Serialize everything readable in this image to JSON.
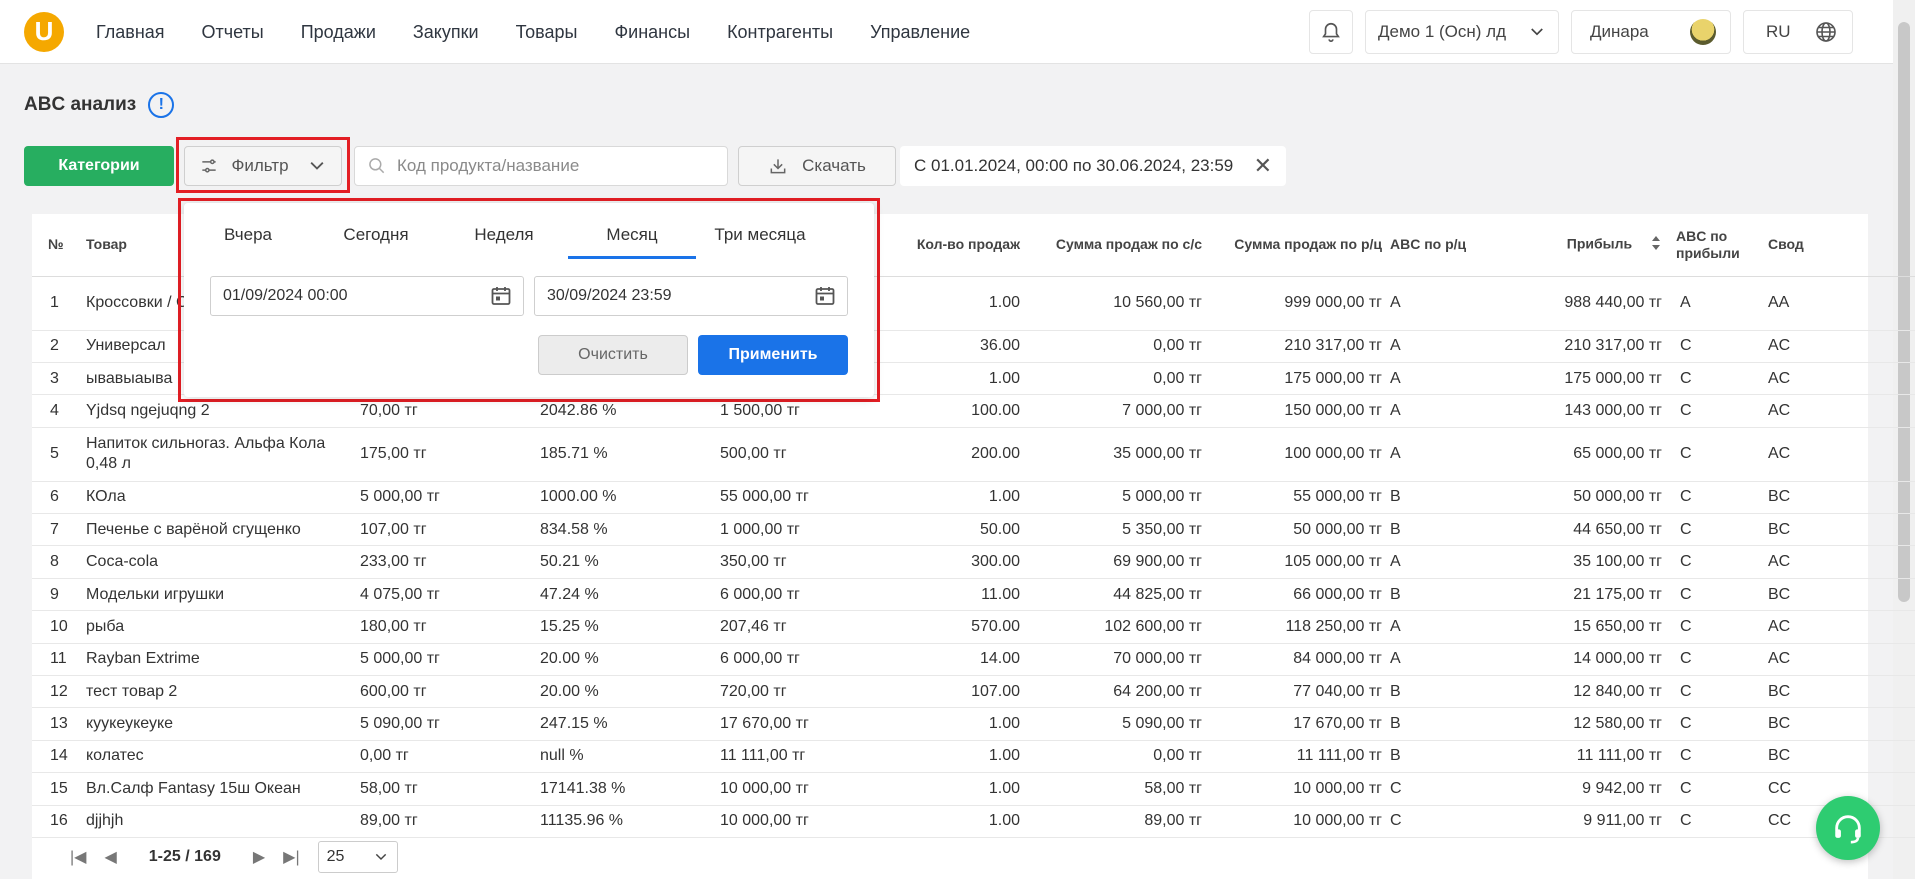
{
  "brand": {
    "logo_letter": "U",
    "accent": "#f5a800"
  },
  "nav": {
    "items": [
      {
        "label": "Главная"
      },
      {
        "label": "Отчеты"
      },
      {
        "label": "Продажи"
      },
      {
        "label": "Закупки"
      },
      {
        "label": "Товары"
      },
      {
        "label": "Финансы"
      },
      {
        "label": "Контрагенты"
      },
      {
        "label": "Управление"
      }
    ]
  },
  "topbar": {
    "company": "Демо 1 (Осн) лд",
    "user": "Динара",
    "lang": "RU"
  },
  "page": {
    "title": "ABC анализ"
  },
  "toolbar": {
    "categories_label": "Категории",
    "filter_label": "Фильтр",
    "search_placeholder": "Код продукта/название",
    "download_label": "Скачать",
    "period_text": "С 01.01.2024, 00:00 по 30.06.2024, 23:59"
  },
  "filter_popup": {
    "tabs": [
      "Вчера",
      "Сегодня",
      "Неделя",
      "Месяц",
      "Три месяца"
    ],
    "active_tab": "Месяц",
    "date_from": "01/09/2024 00:00",
    "date_to": "30/09/2024 23:59",
    "clear_label": "Очистить",
    "apply_label": "Применить"
  },
  "table": {
    "headers": {
      "no": "№",
      "product": "Товар",
      "qty": "Кол-во продаж",
      "sum_cost": "Сумма продаж по с/с",
      "sum_retail": "Сумма продаж по р/ц",
      "abc_retail": "ABC по р/ц",
      "profit": "Прибыль",
      "abc_profit": "ABC по прибыли",
      "summary": "Свод"
    },
    "rows": [
      {
        "no": "1",
        "product": "Кроссовки / С",
        "cost": "",
        "markup": "",
        "retail": "",
        "qty": "1.00",
        "sum_cost": "10 560,00 тг",
        "sum_retail": "999 000,00 тг",
        "abc_retail": "A",
        "profit": "988 440,00 тг",
        "abc_profit": "A",
        "summary": "AA"
      },
      {
        "no": "2",
        "product": "Универсал",
        "cost": "",
        "markup": "",
        "retail": "",
        "qty": "36.00",
        "sum_cost": "0,00 тг",
        "sum_retail": "210 317,00 тг",
        "abc_retail": "A",
        "profit": "210 317,00 тг",
        "abc_profit": "C",
        "summary": "AC"
      },
      {
        "no": "3",
        "product": "ывавыаыва",
        "cost": "",
        "markup": "",
        "retail": "",
        "qty": "1.00",
        "sum_cost": "0,00 тг",
        "sum_retail": "175 000,00 тг",
        "abc_retail": "A",
        "profit": "175 000,00 тг",
        "abc_profit": "C",
        "summary": "AC"
      },
      {
        "no": "4",
        "product": "Yjdsq ngejuqng 2",
        "cost": "70,00 тг",
        "markup": "2042.86 %",
        "retail": "1 500,00 тг",
        "qty": "100.00",
        "sum_cost": "7 000,00 тг",
        "sum_retail": "150 000,00 тг",
        "abc_retail": "A",
        "profit": "143 000,00 тг",
        "abc_profit": "C",
        "summary": "AC"
      },
      {
        "no": "5",
        "product": "Напиток сильногаз. Альфа Кола 0,48 л",
        "cost": "175,00 тг",
        "markup": "185.71 %",
        "retail": "500,00 тг",
        "qty": "200.00",
        "sum_cost": "35 000,00 тг",
        "sum_retail": "100 000,00 тг",
        "abc_retail": "A",
        "profit": "65 000,00 тг",
        "abc_profit": "C",
        "summary": "AC"
      },
      {
        "no": "6",
        "product": "КОла",
        "cost": "5 000,00 тг",
        "markup": "1000.00 %",
        "retail": "55 000,00 тг",
        "qty": "1.00",
        "sum_cost": "5 000,00 тг",
        "sum_retail": "55 000,00 тг",
        "abc_retail": "B",
        "profit": "50 000,00 тг",
        "abc_profit": "C",
        "summary": "BC"
      },
      {
        "no": "7",
        "product": "Печенье с варёной сгущенко",
        "cost": "107,00 тг",
        "markup": "834.58 %",
        "retail": "1 000,00 тг",
        "qty": "50.00",
        "sum_cost": "5 350,00 тг",
        "sum_retail": "50 000,00 тг",
        "abc_retail": "B",
        "profit": "44 650,00 тг",
        "abc_profit": "C",
        "summary": "BC"
      },
      {
        "no": "8",
        "product": "Coca-cola",
        "cost": "233,00 тг",
        "markup": "50.21 %",
        "retail": "350,00 тг",
        "qty": "300.00",
        "sum_cost": "69 900,00 тг",
        "sum_retail": "105 000,00 тг",
        "abc_retail": "A",
        "profit": "35 100,00 тг",
        "abc_profit": "C",
        "summary": "AC"
      },
      {
        "no": "9",
        "product": "Модельки игрушки",
        "cost": "4 075,00 тг",
        "markup": "47.24 %",
        "retail": "6 000,00 тг",
        "qty": "11.00",
        "sum_cost": "44 825,00 тг",
        "sum_retail": "66 000,00 тг",
        "abc_retail": "B",
        "profit": "21 175,00 тг",
        "abc_profit": "C",
        "summary": "BC"
      },
      {
        "no": "10",
        "product": "рыба",
        "cost": "180,00 тг",
        "markup": "15.25 %",
        "retail": "207,46 тг",
        "qty": "570.00",
        "sum_cost": "102 600,00 тг",
        "sum_retail": "118 250,00 тг",
        "abc_retail": "A",
        "profit": "15 650,00 тг",
        "abc_profit": "C",
        "summary": "AC"
      },
      {
        "no": "11",
        "product": "Rayban Extrime",
        "cost": "5 000,00 тг",
        "markup": "20.00 %",
        "retail": "6 000,00 тг",
        "qty": "14.00",
        "sum_cost": "70 000,00 тг",
        "sum_retail": "84 000,00 тг",
        "abc_retail": "A",
        "profit": "14 000,00 тг",
        "abc_profit": "C",
        "summary": "AC"
      },
      {
        "no": "12",
        "product": "тест товар 2",
        "cost": "600,00 тг",
        "markup": "20.00 %",
        "retail": "720,00 тг",
        "qty": "107.00",
        "sum_cost": "64 200,00 тг",
        "sum_retail": "77 040,00 тг",
        "abc_retail": "B",
        "profit": "12 840,00 тг",
        "abc_profit": "C",
        "summary": "BC"
      },
      {
        "no": "13",
        "product": "куукеукеуке",
        "cost": "5 090,00 тг",
        "markup": "247.15 %",
        "retail": "17 670,00 тг",
        "qty": "1.00",
        "sum_cost": "5 090,00 тг",
        "sum_retail": "17 670,00 тг",
        "abc_retail": "B",
        "profit": "12 580,00 тг",
        "abc_profit": "C",
        "summary": "BC"
      },
      {
        "no": "14",
        "product": "колатес",
        "cost": "0,00 тг",
        "markup": "null %",
        "retail": "11 111,00 тг",
        "qty": "1.00",
        "sum_cost": "0,00 тг",
        "sum_retail": "11 111,00 тг",
        "abc_retail": "B",
        "profit": "11 111,00 тг",
        "abc_profit": "C",
        "summary": "BC"
      },
      {
        "no": "15",
        "product": "Вл.Салф Fantasy 15ш Океан",
        "cost": "58,00 тг",
        "markup": "17141.38 %",
        "retail": "10 000,00 тг",
        "qty": "1.00",
        "sum_cost": "58,00 тг",
        "sum_retail": "10 000,00 тг",
        "abc_retail": "C",
        "profit": "9 942,00 тг",
        "abc_profit": "C",
        "summary": "CC"
      },
      {
        "no": "16",
        "product": "djjhjh",
        "cost": "89,00 тг",
        "markup": "11135.96 %",
        "retail": "10 000,00 тг",
        "qty": "1.00",
        "sum_cost": "89,00 тг",
        "sum_retail": "10 000,00 тг",
        "abc_retail": "C",
        "profit": "9 911,00 тг",
        "abc_profit": "C",
        "summary": "CC"
      }
    ]
  },
  "pagination": {
    "range": "1-25 / 169",
    "page_size": "25"
  },
  "colors": {
    "primary": "#1a73e8",
    "success": "#27ae60",
    "highlight": "#e31e24"
  }
}
